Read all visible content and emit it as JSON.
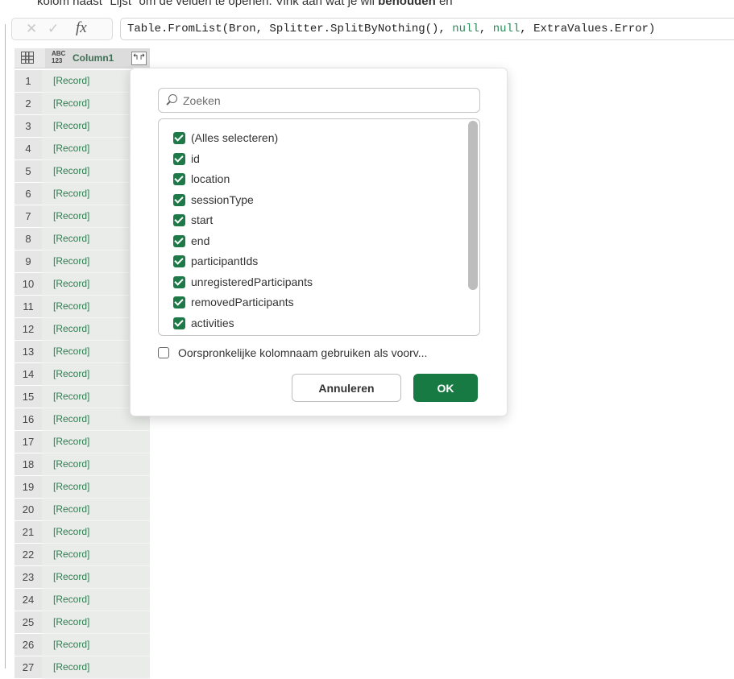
{
  "instruction": {
    "before": "kolom naast \"Lijst\" om de velden te openen. Vink aan wat je wil ",
    "bold": "behouden",
    "after": " en"
  },
  "formula_bar": {
    "cancel_icon": "✕",
    "confirm_icon": "✓",
    "fx_label": "fx",
    "formula_parts": [
      "Table.FromList(Bron, Splitter.SplitByNothing(), ",
      "null",
      ", ",
      "null",
      ", ExtraValues.Error)"
    ]
  },
  "grid": {
    "type_icon_top": "ABC",
    "type_icon_bottom": "123",
    "column_name": "Column1",
    "expand_icon": "↰↱",
    "rows": [
      {
        "num": "1",
        "value": "[Record]"
      },
      {
        "num": "2",
        "value": "[Record]"
      },
      {
        "num": "3",
        "value": "[Record]"
      },
      {
        "num": "4",
        "value": "[Record]"
      },
      {
        "num": "5",
        "value": "[Record]"
      },
      {
        "num": "6",
        "value": "[Record]"
      },
      {
        "num": "7",
        "value": "[Record]"
      },
      {
        "num": "8",
        "value": "[Record]"
      },
      {
        "num": "9",
        "value": "[Record]"
      },
      {
        "num": "10",
        "value": "[Record]"
      },
      {
        "num": "11",
        "value": "[Record]"
      },
      {
        "num": "12",
        "value": "[Record]"
      },
      {
        "num": "13",
        "value": "[Record]"
      },
      {
        "num": "14",
        "value": "[Record]"
      },
      {
        "num": "15",
        "value": "[Record]"
      },
      {
        "num": "16",
        "value": "[Record]"
      },
      {
        "num": "17",
        "value": "[Record]"
      },
      {
        "num": "18",
        "value": "[Record]"
      },
      {
        "num": "19",
        "value": "[Record]"
      },
      {
        "num": "20",
        "value": "[Record]"
      },
      {
        "num": "21",
        "value": "[Record]"
      },
      {
        "num": "22",
        "value": "[Record]"
      },
      {
        "num": "23",
        "value": "[Record]"
      },
      {
        "num": "24",
        "value": "[Record]"
      },
      {
        "num": "25",
        "value": "[Record]"
      },
      {
        "num": "26",
        "value": "[Record]"
      },
      {
        "num": "27",
        "value": "[Record]"
      }
    ]
  },
  "expand_panel": {
    "search_placeholder": "Zoeken",
    "fields": [
      {
        "label": "(Alles selecteren)",
        "checked": true
      },
      {
        "label": "id",
        "checked": true
      },
      {
        "label": "location",
        "checked": true
      },
      {
        "label": "sessionType",
        "checked": true
      },
      {
        "label": "start",
        "checked": true
      },
      {
        "label": "end",
        "checked": true
      },
      {
        "label": "participantIds",
        "checked": true
      },
      {
        "label": "unregisteredParticipants",
        "checked": true
      },
      {
        "label": "removedParticipants",
        "checked": true
      },
      {
        "label": "activities",
        "checked": true
      }
    ],
    "prefix_option": "Oorspronkelijke kolomnaam gebruiken als voorv...",
    "prefix_checked": false,
    "cancel_label": "Annuleren",
    "ok_label": "OK"
  },
  "colors": {
    "accent": "#177a43",
    "record_text": "#2e7d4f",
    "null_keyword": "#2b8a5a"
  }
}
